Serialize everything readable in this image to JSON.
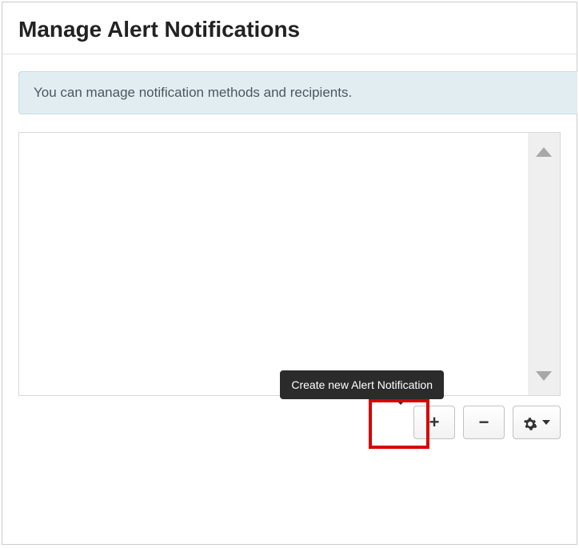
{
  "header": {
    "title": "Manage Alert Notifications"
  },
  "banner": {
    "text": "You can manage notification methods and recipients."
  },
  "list": {
    "items": []
  },
  "toolbar": {
    "add_tooltip": "Create new Alert Notification",
    "add_label": "+",
    "remove_label": "−",
    "gear_label": "⚙"
  }
}
